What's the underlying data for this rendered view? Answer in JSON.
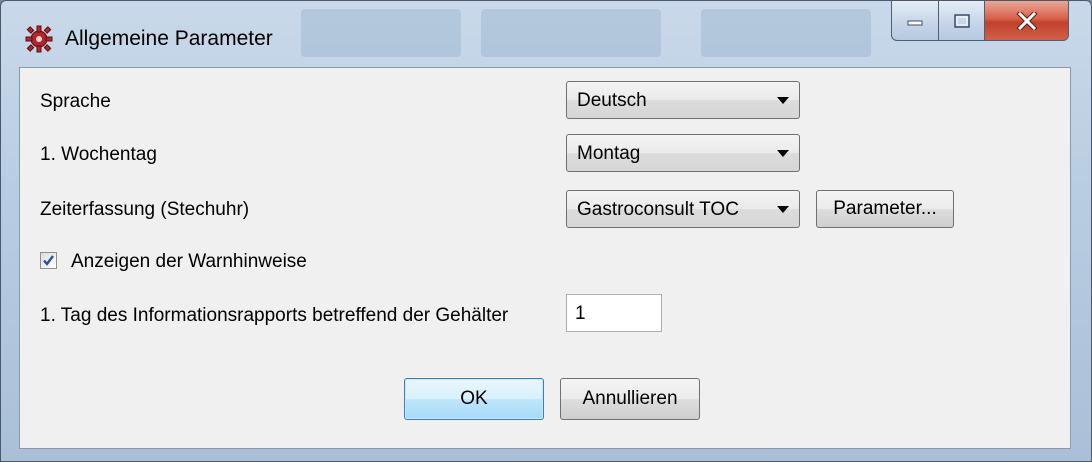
{
  "window": {
    "title": "Allgemeine Parameter",
    "caption_buttons": {
      "minimize_icon": "minimize-icon",
      "maximize_icon": "maximize-icon",
      "close_icon": "close-icon"
    }
  },
  "form": {
    "language": {
      "label": "Sprache",
      "selected": "Deutsch"
    },
    "first_weekday": {
      "label": "1. Wochentag",
      "selected": "Montag"
    },
    "time_recording": {
      "label": "Zeiterfassung (Stechuhr)",
      "selected": "Gastroconsult TOC",
      "parameter_button": "Parameter..."
    },
    "show_warnings": {
      "label": "Anzeigen der Warnhinweise",
      "checked": true
    },
    "info_report_day": {
      "label": "1. Tag des Informationsrapports betreffend der Gehälter",
      "value": "1"
    }
  },
  "buttons": {
    "ok": "OK",
    "cancel": "Annullieren"
  },
  "colors": {
    "client_bg": "#f0f0f0",
    "default_button_border": "#3c7fb1",
    "close_button": "#c2412a"
  }
}
